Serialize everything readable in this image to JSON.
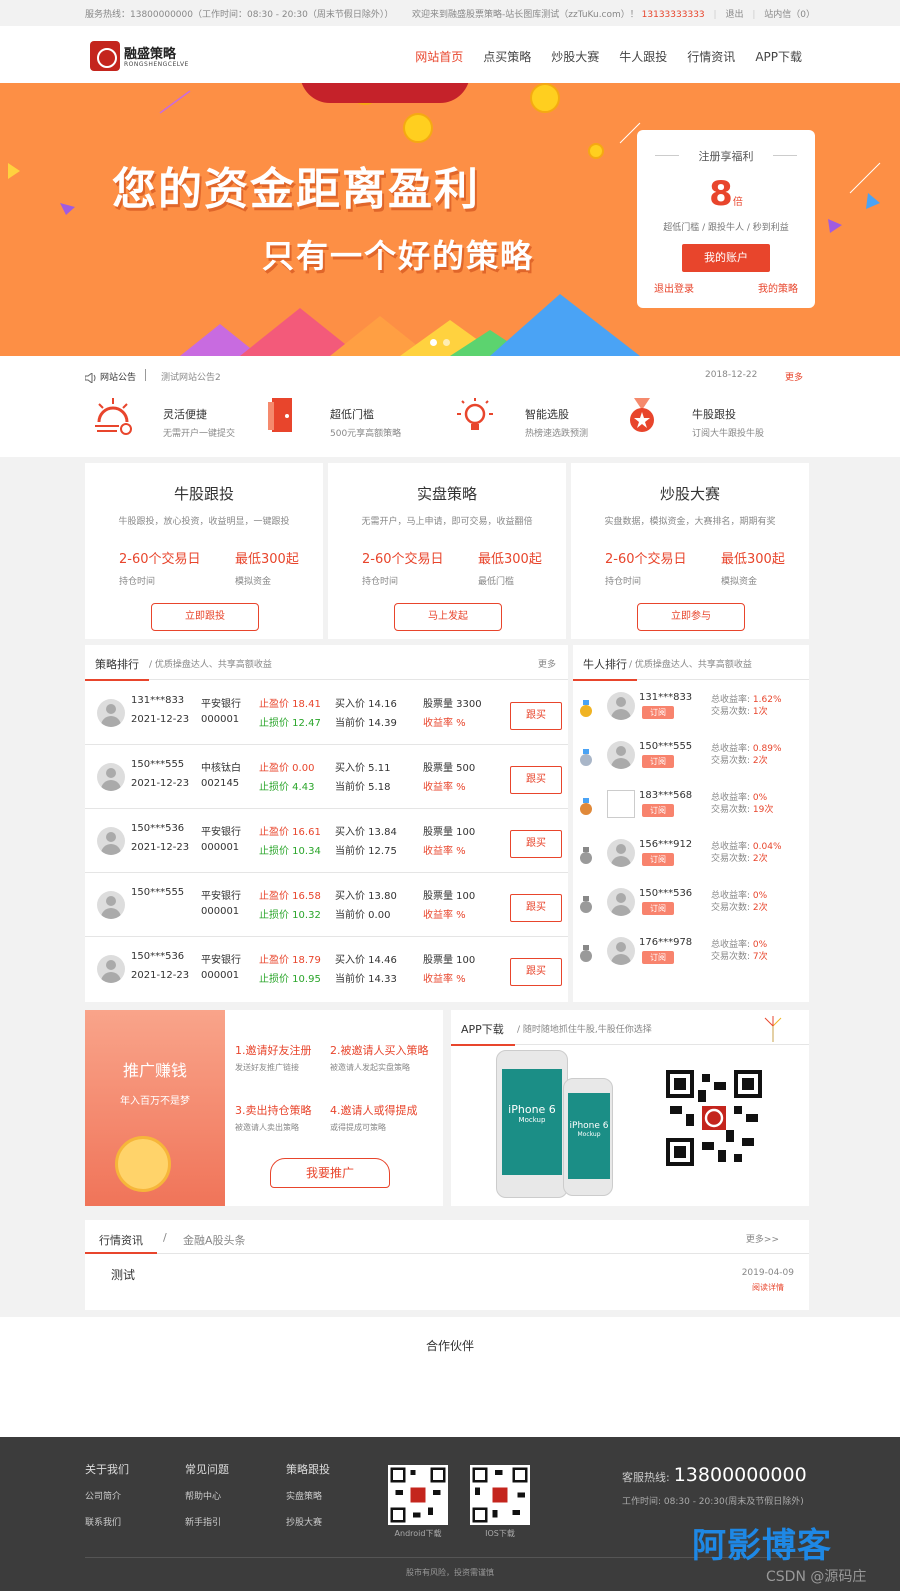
{
  "topbar": {
    "hotline": "服务热线：13800000000（工作时间：08:30 - 20:30（周末节假日除外））",
    "welcome": "欢迎来到融盛股票策略-站长图库测试（zzTuKu.com）！",
    "phone": "13133333333",
    "logout": "退出",
    "message": "站内信（0）"
  },
  "header": {
    "logo_cn": "融盛策略",
    "logo_en": "RONGSHENGCELVE",
    "nav": [
      "网站首页",
      "点买策略",
      "炒股大赛",
      "牛人跟投",
      "行情资讯",
      "APP下载"
    ]
  },
  "banner": {
    "headline1": "您的资金距离盈利",
    "headline2": "只有一个好的策略",
    "card": {
      "title": "注册享福利",
      "big": "8",
      "big_unit": "倍",
      "desc": "超低门槛 / 跟投牛人 / 秒到利益",
      "button": "我的账户",
      "link_left": "退出登录",
      "link_right": "我的策略"
    }
  },
  "notice": {
    "label": "网站公告",
    "text": "测试网站公告2",
    "date": "2018-12-22",
    "more": "更多"
  },
  "features": [
    {
      "title": "灵活便捷",
      "desc": "无需开户一键提交"
    },
    {
      "title": "超低门槛",
      "desc": "500元享高额策略"
    },
    {
      "title": "智能选股",
      "desc": "热榜速选跌预测"
    },
    {
      "title": "牛股跟投",
      "desc": "订阅大牛跟投牛股"
    }
  ],
  "products": [
    {
      "title": "牛股跟投",
      "desc": "牛股跟投，放心投资，收益明显，一键跟投",
      "v1": "2-60个交易日",
      "v2": "最低300起",
      "l1": "持仓时间",
      "l2": "模拟资金",
      "button": "立即跟投"
    },
    {
      "title": "实盘策略",
      "desc": "无需开户，马上申请，即可交易，收益翻倍",
      "v1": "2-60个交易日",
      "v2": "最低300起",
      "l1": "持仓时间",
      "l2": "最低门槛",
      "button": "马上发起"
    },
    {
      "title": "炒股大赛",
      "desc": "实盘数据，模拟资金，大赛排名，期期有奖",
      "v1": "2-60个交易日",
      "v2": "最低300起",
      "l1": "持仓时间",
      "l2": "模拟资金",
      "button": "立即参与"
    }
  ],
  "rank": {
    "title": "策略排行",
    "desc": "/ 优质操盘达人、共享高额收益",
    "more": "更多",
    "follow": "跟买",
    "rows": [
      {
        "user": "131***833",
        "date": "2021-12-23",
        "stock": "平安银行",
        "code": "000001",
        "sp": "止盈价 18.41",
        "sl": "止损价 12.47",
        "buy": "买入价 14.16",
        "cur": "当前价 14.39",
        "qty": "股票量 3300",
        "rate": "收益率 %"
      },
      {
        "user": "150***555",
        "date": "2021-12-23",
        "stock": "中核钛白",
        "code": "002145",
        "sp": "止盈价 0.00",
        "sl": "止损价 4.43",
        "buy": "买入价 5.11",
        "cur": "当前价 5.18",
        "qty": "股票量 500",
        "rate": "收益率 %"
      },
      {
        "user": "150***536",
        "date": "2021-12-23",
        "stock": "平安银行",
        "code": "000001",
        "sp": "止盈价 16.61",
        "sl": "止损价 10.34",
        "buy": "买入价 13.84",
        "cur": "当前价 12.75",
        "qty": "股票量 100",
        "rate": "收益率 %"
      },
      {
        "user": "150***555",
        "date": "",
        "stock": "平安银行",
        "code": "000001",
        "sp": "止盈价 16.58",
        "sl": "止损价 10.32",
        "buy": "买入价 13.80",
        "cur": "当前价 0.00",
        "qty": "股票量 100",
        "rate": "收益率 %"
      },
      {
        "user": "150***536",
        "date": "2021-12-23",
        "stock": "平安银行",
        "code": "000001",
        "sp": "止盈价 18.79",
        "sl": "止损价 10.95",
        "buy": "买入价 14.46",
        "cur": "当前价 14.33",
        "qty": "股票量 100",
        "rate": "收益率 %"
      }
    ]
  },
  "people": {
    "title": "牛人排行",
    "desc": "/ 优质操盘达人、共享高额收益",
    "subscribe": "订阅",
    "rows": [
      {
        "user": "131***833",
        "profit_label": "总收益率:",
        "profit": "1.62%",
        "trades_label": "交易次数:",
        "trades": "1次",
        "medal": "#f0b323"
      },
      {
        "user": "150***555",
        "profit_label": "总收益率:",
        "profit": "0.89%",
        "trades_label": "交易次数:",
        "trades": "2次",
        "medal": "#a9b6c8"
      },
      {
        "user": "183***568",
        "profit_label": "总收益率:",
        "profit": "0%",
        "trades_label": "交易次数:",
        "trades": "19次",
        "medal": "#e0893a"
      },
      {
        "user": "156***912",
        "profit_label": "总收益率:",
        "profit": "0.04%",
        "trades_label": "交易次数:",
        "trades": "2次",
        "medal": "#9a9a9a"
      },
      {
        "user": "150***536",
        "profit_label": "总收益率:",
        "profit": "0%",
        "trades_label": "交易次数:",
        "trades": "2次",
        "medal": "#9a9a9a"
      },
      {
        "user": "176***978",
        "profit_label": "总收益率:",
        "profit": "0%",
        "trades_label": "交易次数:",
        "trades": "7次",
        "medal": "#9a9a9a"
      }
    ]
  },
  "promo": {
    "title": "推广赚钱",
    "slogan": "年入百万不是梦",
    "steps": [
      {
        "title": "1.邀请好友注册",
        "desc": "发送好友推广链接"
      },
      {
        "title": "2.被邀请人买入策略",
        "desc": "被邀请人发起实盘策略"
      },
      {
        "title": "3.卖出持仓策略",
        "desc": "被邀请人卖出策略"
      },
      {
        "title": "4.邀请人或得提成",
        "desc": "或得提成可策略"
      }
    ],
    "button": "我要推广"
  },
  "app": {
    "title": "APP下载",
    "desc": "/ 随时随地抓住牛股,牛股任你选择",
    "phone_model": "iPhone 6",
    "phone_sub": "Mockup"
  },
  "news": {
    "tab1": "行情资讯",
    "slash": "/",
    "tab2": "金融A股头条",
    "more": "更多>>",
    "item": "测试",
    "date": "2019-04-09",
    "read": "阅读详情"
  },
  "partners": {
    "title": "合作伙伴"
  },
  "footer": {
    "cols": [
      {
        "head": "关于我们",
        "items": [
          "公司简介",
          "联系我们"
        ]
      },
      {
        "head": "常见问题",
        "items": [
          "帮助中心",
          "新手指引"
        ]
      },
      {
        "head": "策略跟投",
        "items": [
          "实盘策略",
          "抄股大赛"
        ]
      }
    ],
    "qr_android": "Android下载",
    "qr_ios": "IOS下载",
    "hotline_label": "客服热线:",
    "hotline": "13800000000",
    "worktime": "工作时间: 08:30 - 20:30(周末及节假日除外)",
    "copyright": "股市有风险，投资需谨慎"
  },
  "watermark": {
    "text": "阿影博客",
    "sub": "CSDN @源码庄"
  }
}
